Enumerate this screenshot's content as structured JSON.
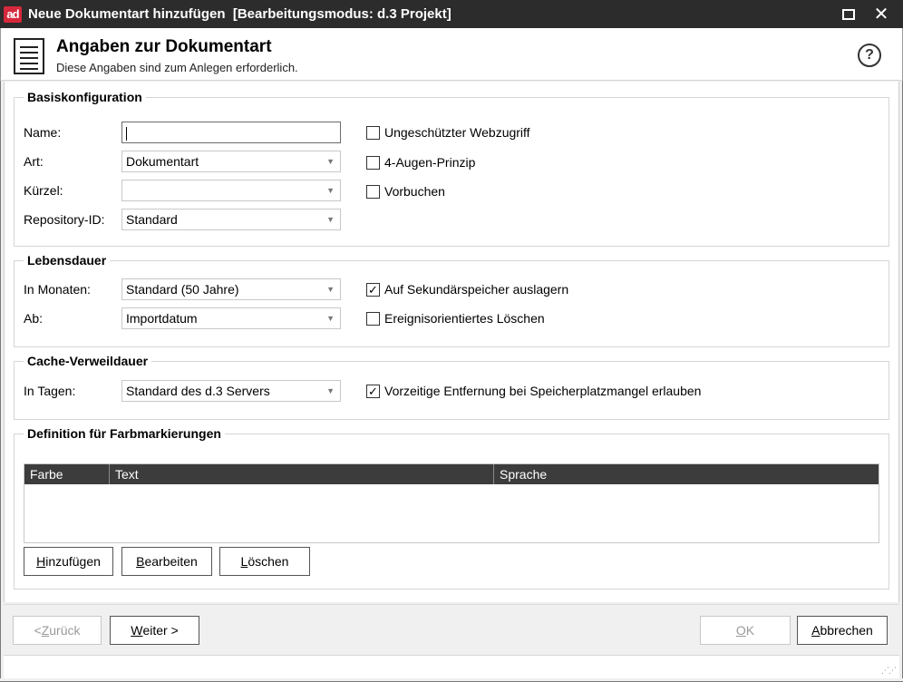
{
  "window": {
    "title": "Neue Dokumentart hinzufügen  [Bearbeitungsmodus: d.3 Projekt]",
    "logo_text": "ad",
    "logo_color": "#d6283c"
  },
  "header": {
    "title": "Angaben zur Dokumentart",
    "subtitle": "Diese Angaben sind zum Anlegen erforderlich.",
    "help_glyph": "?"
  },
  "basis": {
    "legend": "Basiskonfiguration",
    "name_label": "Name:",
    "name_value": "",
    "art_label": "Art:",
    "art_value": "Dokumentart",
    "kuerzel_label": "Kürzel:",
    "kuerzel_value": "",
    "repo_label": "Repository-ID:",
    "repo_value": "Standard",
    "cb_webzugriff": {
      "label": "Ungeschützter Webzugriff",
      "checked": false
    },
    "cb_vieraugen": {
      "label": "4-Augen-Prinzip",
      "checked": false
    },
    "cb_vorbuchen": {
      "label": "Vorbuchen",
      "checked": false
    }
  },
  "lebensdauer": {
    "legend": "Lebensdauer",
    "monate_label": "In Monaten:",
    "monate_value": "Standard (50 Jahre)",
    "ab_label": "Ab:",
    "ab_value": "Importdatum",
    "cb_sekundaer": {
      "label": "Auf Sekundärspeicher auslagern",
      "checked": true
    },
    "cb_ereignis": {
      "label": "Ereignisorientiertes Löschen",
      "checked": false
    }
  },
  "cache": {
    "legend": "Cache-Verweildauer",
    "tage_label": "In Tagen:",
    "tage_value": "Standard des d.3 Servers",
    "cb_vorzeitig": {
      "label": "Vorzeitige Entfernung bei Speicherplatzmangel erlauben",
      "checked": true
    }
  },
  "farb": {
    "legend": "Definition für Farbmarkierungen",
    "columns": [
      "Farbe",
      "Text",
      "Sprache"
    ],
    "rows": [],
    "btn_add_ul": "H",
    "btn_add_rest": "inzufügen",
    "btn_edit_ul": "B",
    "btn_edit_rest": "earbeiten",
    "btn_delete_ul": "L",
    "btn_delete_rest": "öschen"
  },
  "footer": {
    "back_pre": "< ",
    "back_ul": "Z",
    "back_rest": "urück",
    "next_ul": "W",
    "next_rest": "eiter >",
    "ok_ul": "O",
    "ok_rest": "K",
    "cancel_ul": "A",
    "cancel_rest": "bbrechen"
  }
}
